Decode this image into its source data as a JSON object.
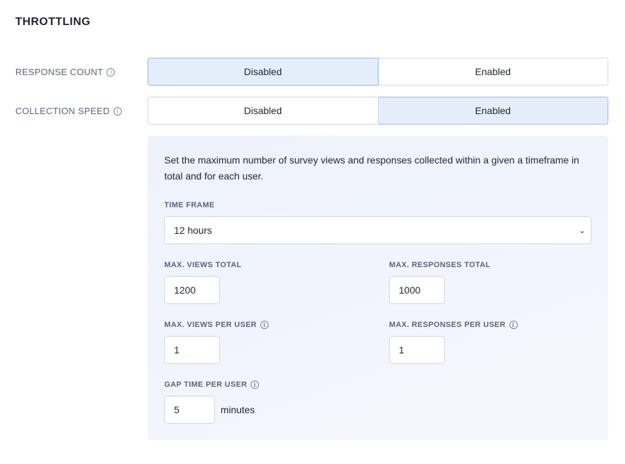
{
  "title": "THROTTLING",
  "response_count": {
    "label": "RESPONSE COUNT",
    "options": [
      "Disabled",
      "Enabled"
    ],
    "selected": "Disabled"
  },
  "collection_speed": {
    "label": "COLLECTION SPEED",
    "options": [
      "Disabled",
      "Enabled"
    ],
    "selected": "Enabled"
  },
  "panel": {
    "description": "Set the maximum number of survey views and responses collected within a given a timeframe in total and for each user.",
    "time_frame": {
      "label": "TIME FRAME",
      "value": "12 hours"
    },
    "max_views_total": {
      "label": "MAX. VIEWS TOTAL",
      "value": "1200"
    },
    "max_responses_total": {
      "label": "MAX. RESPONSES TOTAL",
      "value": "1000"
    },
    "max_views_per_user": {
      "label": "MAX. VIEWS PER USER",
      "value": "1"
    },
    "max_responses_per_user": {
      "label": "MAX. RESPONSES PER USER",
      "value": "1"
    },
    "gap_time_per_user": {
      "label": "GAP TIME PER USER",
      "value": "5",
      "unit": "minutes"
    }
  }
}
